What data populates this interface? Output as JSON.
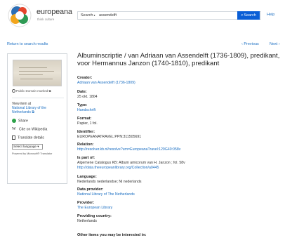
{
  "header": {
    "logo_text": "europeana",
    "logo_sub": "think culture",
    "search_scope": "Search",
    "search_value": "assendelft",
    "search_button": "Search",
    "help": "Help"
  },
  "nav": {
    "back": "Return to search results",
    "previous": "‹ Previous",
    "next": "Next ›"
  },
  "left": {
    "rights": "Public Domain marked",
    "view_item_label": "View item at",
    "view_item_link": "National Library of the Netherlands",
    "share": "Share",
    "cite": "Cite on Wikipedia",
    "translate": "Translate details",
    "select_language": "Select language",
    "powered": "Powered by Microsoft® Translator"
  },
  "record": {
    "title": "Albuminscriptie / van Adriaan van Assendelft (1736-1809), predikant, voor Hermannus Janzon (1740-1810), predikant",
    "fields": [
      {
        "label": "Creator:",
        "value": "Adriaan van Assendelft (1736-1809)",
        "is_link": true
      },
      {
        "label": "Date:",
        "value": "25 okt. 1804",
        "is_link": false
      },
      {
        "label": "Type:",
        "value": "Handschrift",
        "is_link": true
      },
      {
        "label": "Format:",
        "value": "Papier, 1 fol.",
        "is_link": false
      },
      {
        "label": "Identifier:",
        "value": "EUROPEANATRAVEL:PPN:311505691",
        "is_link": false
      },
      {
        "label": "Relation:",
        "value": "http://resolver.kb.nl/resolve?urn=EuropeanaTravel:129G40:058v",
        "is_link": true
      },
      {
        "label": "Is part of:",
        "value": "Algemene Catalogus KB: Album amicorum van H. Janzon ; fol. 58v",
        "is_link": false
      },
      {
        "label": "",
        "value": "http://data.theeuropeanlibrary.org/Collection/a0445",
        "is_link": true
      },
      {
        "label": "Language:",
        "value": "Nederlands nederlandse; Nl nederlands",
        "is_link": false
      },
      {
        "label": "Data provider:",
        "value": "National Library of The Netherlands",
        "is_link": true
      },
      {
        "label": "Provider:",
        "value": "The European Library",
        "is_link": true
      },
      {
        "label": "Providing country:",
        "value": "Netherlands",
        "is_link": false
      }
    ],
    "other_items": "Other items you may be interested in:"
  },
  "colors": {
    "link": "#1a6ec2",
    "search_button": "#0b5fd6",
    "share_icon": "#2ea24a"
  }
}
